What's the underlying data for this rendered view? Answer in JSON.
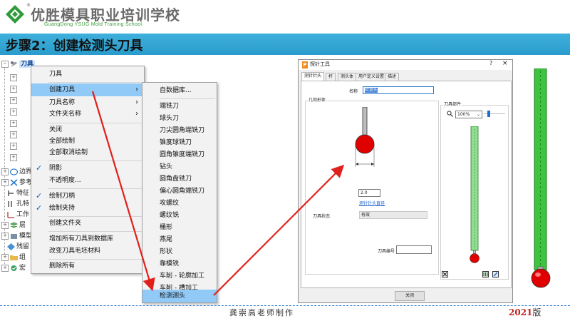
{
  "header": {
    "brand_cn": "优胜模具职业培训学校",
    "brand_en": "GuangDong YSUG Mold Training School",
    "registered": "®"
  },
  "step": {
    "title": "步骤2：创建检测头刀具"
  },
  "tree": {
    "root_label": "刀具",
    "items": [
      {
        "label": "边界"
      },
      {
        "label": "参考"
      },
      {
        "label": "特征"
      },
      {
        "label": "孔特"
      },
      {
        "label": "工作"
      },
      {
        "label": "层"
      },
      {
        "label": "模型"
      },
      {
        "label": "残留"
      },
      {
        "label": "组"
      },
      {
        "label": "宏"
      }
    ]
  },
  "context_menu": {
    "items": [
      {
        "label": "刀具",
        "checked": false,
        "submenu": false
      },
      {
        "label": "创建刀具",
        "checked": false,
        "submenu": true,
        "highlight": true
      },
      {
        "label": "刀具名称",
        "checked": false,
        "submenu": true
      },
      {
        "label": "文件夹名称",
        "checked": false,
        "submenu": true
      },
      {
        "label": "关闭",
        "checked": false,
        "submenu": false
      },
      {
        "label": "全部绘制",
        "checked": false,
        "submenu": false
      },
      {
        "label": "全部取消绘制",
        "checked": false,
        "submenu": false
      },
      {
        "label": "阴影",
        "checked": true,
        "submenu": false
      },
      {
        "label": "不透明度...",
        "checked": false,
        "submenu": false
      },
      {
        "label": "绘制刀柄",
        "checked": true,
        "submenu": false
      },
      {
        "label": "绘制夹持",
        "checked": true,
        "submenu": false
      },
      {
        "label": "创建文件夹",
        "checked": false,
        "submenu": false
      },
      {
        "label": "增加所有刀具到数据库",
        "checked": false,
        "submenu": false
      },
      {
        "label": "改变刀具毛坯材料",
        "checked": false,
        "submenu": false
      },
      {
        "label": "删除所有",
        "checked": false,
        "submenu": false
      }
    ]
  },
  "submenu": {
    "items": [
      {
        "label": "自数据库..."
      },
      {
        "label": "端铣刀"
      },
      {
        "label": "球头刀"
      },
      {
        "label": "刀尖圆角端铣刀"
      },
      {
        "label": "锥度球铣刀"
      },
      {
        "label": "圆角锥度端铣刀"
      },
      {
        "label": "钻头"
      },
      {
        "label": "圆角盘铣刀"
      },
      {
        "label": "偏心圆角端铣刀"
      },
      {
        "label": "攻螺纹"
      },
      {
        "label": "螺纹铣"
      },
      {
        "label": "桶形"
      },
      {
        "label": "燕尾"
      },
      {
        "label": "形状"
      },
      {
        "label": "靠模铣"
      },
      {
        "label": "车削 - 轮廓加工"
      },
      {
        "label": "车削 - 槽加工"
      },
      {
        "label": "检测测头",
        "highlight": true
      }
    ]
  },
  "dialog": {
    "icon": "P",
    "title": "探针工具",
    "help": "?",
    "close": "×",
    "tabs": [
      "测针针头",
      "杆",
      "测头体",
      "用户定义设置",
      "描述"
    ],
    "name_label": "名称",
    "name_value": "检测头",
    "geometry_label": "几何形体",
    "diameter_value": "2.0",
    "diameter_link": "测针针头直径",
    "status_label": "刀具状态",
    "status_value": "有效",
    "tool_number_label": "刀具编号",
    "tool_number_value": "",
    "assembly_label": "刀具部件",
    "zoom_value": "100%",
    "close_button": "关闭"
  },
  "footer": {
    "author": "龚崇高老师制作",
    "year": "2021",
    "year_suffix": "版"
  },
  "colors": {
    "step_bar": "#2a9ccc",
    "highlight": "#91c9f7",
    "arrow": "#e0201c",
    "probe_ball": "#e00000",
    "stylus_green": "#3ec43e"
  }
}
